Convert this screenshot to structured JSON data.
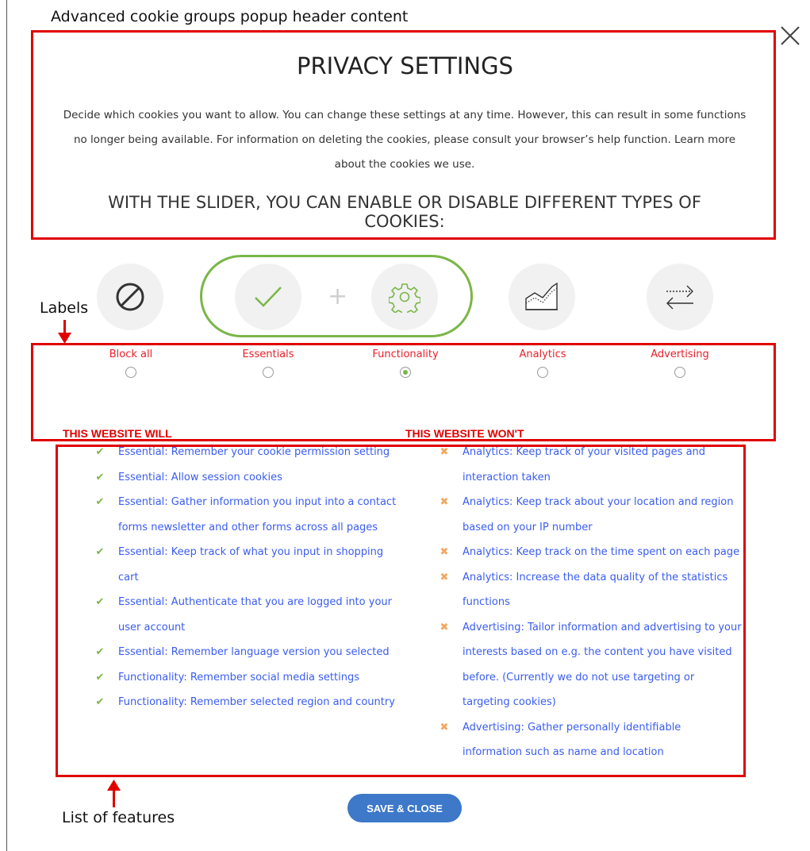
{
  "annotations": {
    "header": "Advanced cookie groups popup header content",
    "labels": "Labels",
    "list": "List of features"
  },
  "popup": {
    "title": "PRIVACY SETTINGS",
    "description": "Decide which cookies you want to allow. You can change these settings at any time. However, this can result in some functions no longer being available. For information on deleting the cookies, please consult your browser’s help function. Learn more about the cookies we use.",
    "subheading": "WITH THE SLIDER, YOU CAN ENABLE OR DISABLE DIFFERENT TYPES OF COOKIES:"
  },
  "options": [
    {
      "label": "Block all",
      "icon": "block-icon",
      "selected": false
    },
    {
      "label": "Essentials",
      "icon": "check-icon",
      "selected": false
    },
    {
      "label": "Functionality",
      "icon": "gear-icon",
      "selected": true
    },
    {
      "label": "Analytics",
      "icon": "chart-icon",
      "selected": false
    },
    {
      "label": "Advertising",
      "icon": "swap-arrows-icon",
      "selected": false
    }
  ],
  "will": {
    "heading": "THIS WEBSITE WILL",
    "items": [
      "Essential: Remember your cookie permission setting",
      "Essential: Allow session cookies",
      "Essential: Gather information you input into a contact forms newsletter and other forms across all pages",
      "Essential: Keep track of what you input in shopping cart",
      "Essential: Authenticate that you are logged into your user account",
      "Essential: Remember language version you selected",
      "Functionality: Remember social media settings",
      "Functionality: Remember selected region and country"
    ]
  },
  "wont": {
    "heading": "THIS WEBSITE WON'T",
    "items": [
      "Analytics: Keep track of your visited pages and interaction taken",
      "Analytics: Keep track about your location and region based on your IP number",
      "Analytics: Keep track on the time spent on each page",
      "Analytics: Increase the data quality of the statistics functions",
      "Advertising: Tailor information and advertising to your interests based on e.g. the content you have visited before. (Currently we do not use targeting or targeting cookies)",
      "Advertising: Gather personally identifiable information such as name and location"
    ]
  },
  "save_button": "SAVE & CLOSE",
  "colors": {
    "accent_green": "#7ab648",
    "annotation_red": "#e00000",
    "label_red": "#e8202a",
    "list_blue": "#3a5cf0",
    "cross_orange": "#f0a860",
    "button_blue": "#3d78c9"
  }
}
